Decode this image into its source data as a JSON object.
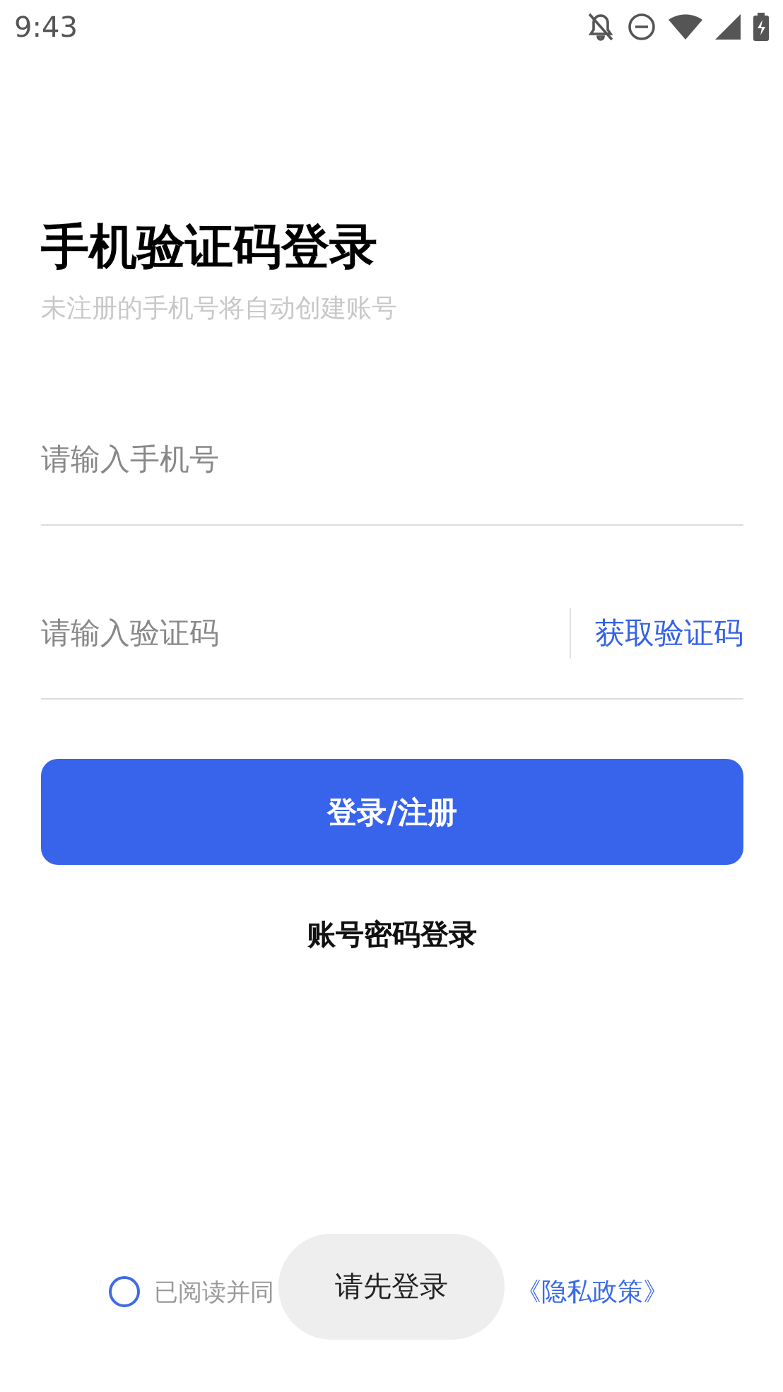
{
  "status_bar": {
    "time": "9:43"
  },
  "title": "手机验证码登录",
  "subtitle": "未注册的手机号将自动创建账号",
  "phone_field": {
    "placeholder": "请输入手机号"
  },
  "code_field": {
    "placeholder": "请输入验证码",
    "action": "获取验证码"
  },
  "submit_button": "登录/注册",
  "alt_login_link": "账号密码登录",
  "agreement": {
    "checked": false,
    "prefix": "已阅读并同",
    "privacy_link": "《隐私政策》"
  },
  "toast": "请先登录"
}
